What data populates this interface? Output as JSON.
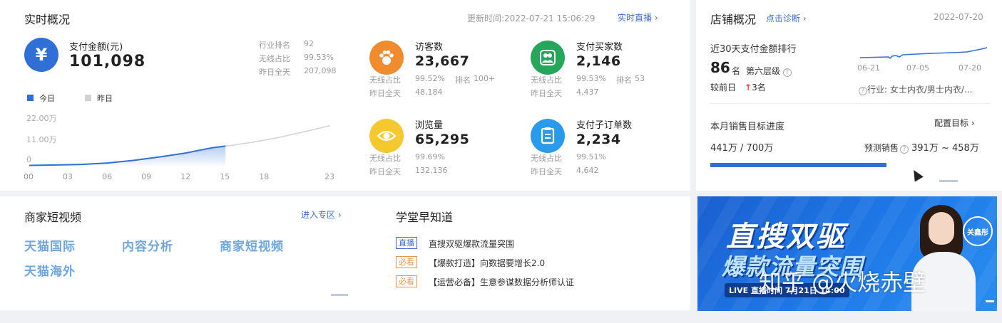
{
  "realtime": {
    "title": "实时概况",
    "update_label": "更新时间:",
    "update_time": "2022-07-21 15:06:29",
    "live_link": "实时直播",
    "payment": {
      "label": "支付金额(元)",
      "value": "101,098",
      "stats": [
        {
          "label": "行业排名",
          "value": "92"
        },
        {
          "label": "无线占比",
          "value": "99.53%"
        },
        {
          "label": "昨日全天",
          "value": "207,098"
        }
      ]
    },
    "legend": {
      "today": "今日",
      "yesterday": "昨日"
    },
    "chart_data": {
      "type": "area",
      "yticks": [
        "22.00万",
        "11.00万",
        "0"
      ],
      "xticks": [
        "00",
        "03",
        "06",
        "09",
        "12",
        "15",
        "18",
        "23"
      ],
      "ylim": [
        0,
        220000
      ],
      "x_hours": [
        0,
        3,
        6,
        9,
        12,
        15,
        18,
        23
      ],
      "series": [
        {
          "name": "今日",
          "x": [
            0,
            2,
            4,
            6,
            8,
            10,
            12,
            13,
            14,
            15
          ],
          "values": [
            2000,
            4000,
            7000,
            14000,
            28000,
            46000,
            66000,
            80000,
            93000,
            101098
          ]
        },
        {
          "name": "昨日",
          "x": [
            15,
            17,
            19,
            21,
            23
          ],
          "values": [
            101098,
            120000,
            145000,
            175000,
            207098
          ]
        }
      ],
      "colors": {
        "today": "#2f6fd6",
        "yesterday": "#d3d3d3"
      }
    },
    "metrics": [
      {
        "label": "访客数",
        "value": "23,667",
        "color": "#f08c2d",
        "icon": "paw-icon",
        "stats": [
          {
            "label": "无线占比",
            "value": "99.52%"
          },
          {
            "label": "昨日全天",
            "value": "48,184"
          }
        ],
        "rank_label": "排名",
        "rank_value": "100+"
      },
      {
        "label": "支付买家数",
        "value": "2,146",
        "color": "#25a65a",
        "icon": "buyers-icon",
        "stats": [
          {
            "label": "无线占比",
            "value": "99.53%"
          },
          {
            "label": "昨日全天",
            "value": "4,437"
          }
        ],
        "rank_label": "排名",
        "rank_value": "53"
      },
      {
        "label": "浏览量",
        "value": "65,295",
        "color": "#f6c82f",
        "icon": "eye-icon",
        "stats": [
          {
            "label": "无线占比",
            "value": "99.69%"
          },
          {
            "label": "昨日全天",
            "value": "132,136"
          }
        ]
      },
      {
        "label": "支付子订单数",
        "value": "2,234",
        "color": "#2a9bea",
        "icon": "order-icon",
        "stats": [
          {
            "label": "无线占比",
            "value": "99.51%"
          },
          {
            "label": "昨日全天",
            "value": "4,642"
          }
        ]
      }
    ]
  },
  "shop": {
    "title": "店铺概况",
    "diagnose_link": "点击诊断",
    "date": "2022-07-20",
    "rank_title": "近30天支付金额排行",
    "rank_value": "86",
    "rank_unit": "名",
    "level": "第六层级",
    "compare_label": "较前日",
    "compare_value": "3名",
    "industry": "行业: 女士内衣/男士内衣/...",
    "trend_x": [
      "06-21",
      "07-05",
      "07-20"
    ],
    "goal_title": "本月销售目标进度",
    "goal_link": "配置目标",
    "goal_value": "441万 / 700万",
    "goal_progress": 0.63,
    "forecast_label": "预测销售",
    "forecast_value": "391万 ~ 458万"
  },
  "video": {
    "title": "商家短视频",
    "enter_link": "进入专区",
    "items": [
      "天猫国际",
      "内容分析",
      "商家短视频",
      "天猫海外"
    ]
  },
  "academy": {
    "title": "学堂早知道",
    "items": [
      {
        "tag": "直播",
        "text": "直搜双驱爆款流量突围",
        "tag_color": "#3a6fd8"
      },
      {
        "tag": "必看",
        "text": "【爆款打造】向数据要增长2.0",
        "tag_color": "#e8954a"
      },
      {
        "tag": "必看",
        "text": "【运营必备】生意参谋数据分析师认证",
        "tag_color": "#e8954a"
      }
    ]
  },
  "banner": {
    "line1": "直搜双驱",
    "line2": "爆款流量突围",
    "badge": "关鑫彤",
    "live_text": "LIVE 直播时间 7月21日 14:00",
    "watermark": "知乎 @火烧赤壁"
  }
}
